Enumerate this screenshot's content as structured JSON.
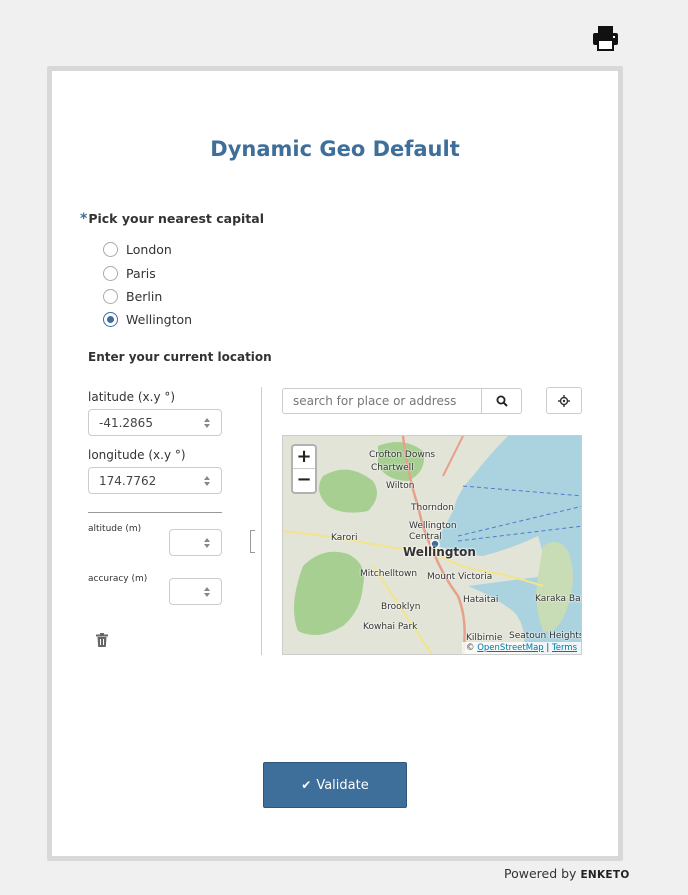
{
  "toolbar": {
    "print_icon": "print-icon"
  },
  "form": {
    "title": "Dynamic Geo Default",
    "question1": {
      "required_mark": "*",
      "label": "Pick your nearest capital",
      "options": [
        {
          "label": "London",
          "selected": false
        },
        {
          "label": "Paris",
          "selected": false
        },
        {
          "label": "Berlin",
          "selected": false
        },
        {
          "label": "Wellington",
          "selected": true
        }
      ]
    },
    "question2": {
      "label": "Enter your current location",
      "latitude_label": "latitude (x.y °)",
      "latitude_value": "-41.2865",
      "longitude_label": "longitude (x.y °)",
      "longitude_value": "174.7762",
      "altitude_label": "altitude (m)",
      "altitude_value": "",
      "accuracy_label": "accuracy (m)",
      "accuracy_value": "",
      "search_placeholder": "search for place or address",
      "map": {
        "zoom_in": "+",
        "zoom_out": "−",
        "attribution_prefix": "© ",
        "attribution_osm": "OpenStreetMap",
        "attribution_sep": " | ",
        "attribution_terms": "Terms",
        "places": [
          "Crofton Downs",
          "Chartwell",
          "Wilton",
          "Thorndon",
          "Wellington Central",
          "Wellington",
          "Karori",
          "Mitchelltown",
          "Mount Victoria",
          "Hataitai",
          "Brooklyn",
          "Kowhai Park",
          "Karaka Bay",
          "Kilbirnie",
          "Seatoun Heights"
        ]
      }
    },
    "validate_label": "Validate"
  },
  "footer": {
    "powered_by": "Powered by",
    "brand": "ENKETO"
  },
  "colors": {
    "accent": "#3e6e9a",
    "background": "#f0f0f0"
  }
}
